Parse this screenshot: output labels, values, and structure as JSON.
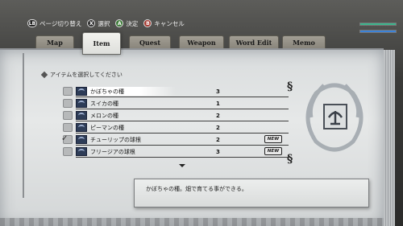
{
  "help": {
    "page_switch": "ページ切り替え",
    "select": "選択",
    "confirm": "決定",
    "cancel": "キャンセル",
    "btn_lb": "LB",
    "btn_x": "X",
    "btn_a": "A",
    "btn_b": "B"
  },
  "tabs": {
    "map": "Map",
    "item": "Item",
    "quest": "Quest",
    "weapon": "Weapon",
    "word_edit": "Word Edit",
    "memo": "Memo"
  },
  "instruction": "アイテムを選択してください",
  "items": [
    {
      "name": "かぼちゃの種",
      "qty": "3",
      "new": ""
    },
    {
      "name": "スイカの種",
      "qty": "1",
      "new": ""
    },
    {
      "name": "メロンの種",
      "qty": "2",
      "new": ""
    },
    {
      "name": "ピーマンの種",
      "qty": "2",
      "new": ""
    },
    {
      "name": "チューリップの球根",
      "qty": "2",
      "new": "NEW"
    },
    {
      "name": "フリージアの球根",
      "qty": "3",
      "new": "NEW"
    }
  ],
  "description": "かぼちゃの種。畑で育てる事ができる。",
  "status": {
    "hp_fraction": 1.0,
    "sp_fraction": 1.0,
    "hp_color": "#3cb48c",
    "sp_color": "#3b82d8"
  }
}
